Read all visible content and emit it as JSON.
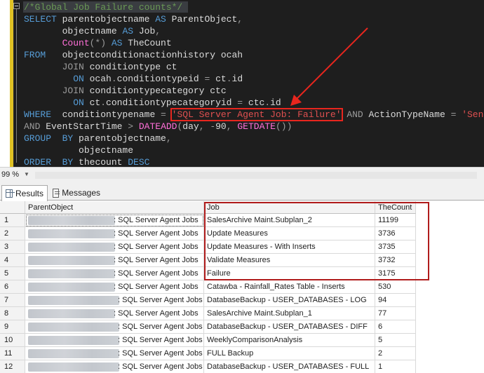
{
  "editor": {
    "lines": [
      [
        {
          "t": "/*Global Job Failure counts*/",
          "c": "cmt"
        }
      ],
      [
        {
          "t": "SELECT",
          "c": "kw"
        },
        {
          "t": " parentobjectname "
        },
        {
          "t": "AS",
          "c": "kw"
        },
        {
          "t": " ParentObject"
        },
        {
          "t": ",",
          "c": "gray"
        }
      ],
      [
        {
          "t": "       objectname "
        },
        {
          "t": "AS",
          "c": "kw"
        },
        {
          "t": " Job"
        },
        {
          "t": ",",
          "c": "gray"
        }
      ],
      [
        {
          "t": "       "
        },
        {
          "t": "Count",
          "c": "fn"
        },
        {
          "t": "(*)",
          "c": "gray"
        },
        {
          "t": " "
        },
        {
          "t": "AS",
          "c": "kw"
        },
        {
          "t": " TheCount"
        }
      ],
      [
        {
          "t": "FROM",
          "c": "kw"
        },
        {
          "t": "   objectconditionactionhistory ocah"
        }
      ],
      [
        {
          "t": "       "
        },
        {
          "t": "JOIN",
          "c": "gray"
        },
        {
          "t": " conditiontype ct"
        }
      ],
      [
        {
          "t": "         "
        },
        {
          "t": "ON",
          "c": "kw"
        },
        {
          "t": " ocah"
        },
        {
          "t": ".",
          "c": "gray"
        },
        {
          "t": "conditiontypeid "
        },
        {
          "t": "=",
          "c": "gray"
        },
        {
          "t": " ct"
        },
        {
          "t": ".",
          "c": "gray"
        },
        {
          "t": "id"
        }
      ],
      [
        {
          "t": "       "
        },
        {
          "t": "JOIN",
          "c": "gray"
        },
        {
          "t": " conditiontypecategory ctc"
        }
      ],
      [
        {
          "t": "         "
        },
        {
          "t": "ON",
          "c": "kw"
        },
        {
          "t": " ct"
        },
        {
          "t": ".",
          "c": "gray"
        },
        {
          "t": "conditiontypecategoryid "
        },
        {
          "t": "=",
          "c": "gray"
        },
        {
          "t": " ctc"
        },
        {
          "t": ".",
          "c": "gray"
        },
        {
          "t": "id"
        }
      ],
      [
        {
          "t": "WHERE",
          "c": "kw"
        },
        {
          "t": "  conditiontypename "
        },
        {
          "t": "=",
          "c": "gray"
        },
        {
          "t": " "
        },
        {
          "t": "'SQL Server Agent Job: Failure'",
          "c": "str",
          "hl": true
        },
        {
          "t": " "
        },
        {
          "t": "AND",
          "c": "gray"
        },
        {
          "t": " ActionTypeName "
        },
        {
          "t": "=",
          "c": "gray"
        },
        {
          "t": " "
        },
        {
          "t": "'Send Email'",
          "c": "str"
        }
      ],
      [
        {
          "t": "AND",
          "c": "gray"
        },
        {
          "t": " EventStartTime "
        },
        {
          "t": ">",
          "c": "gray"
        },
        {
          "t": " "
        },
        {
          "t": "DATEADD",
          "c": "fn"
        },
        {
          "t": "(",
          "c": "gray"
        },
        {
          "t": "day"
        },
        {
          "t": ",",
          "c": "gray"
        },
        {
          "t": " "
        },
        {
          "t": "-",
          "c": "gray"
        },
        {
          "t": "90"
        },
        {
          "t": ",",
          "c": "gray"
        },
        {
          "t": " "
        },
        {
          "t": "GETDATE",
          "c": "fn"
        },
        {
          "t": "())",
          "c": "gray"
        }
      ],
      [
        {
          "t": "GROUP",
          "c": "kw"
        },
        {
          "t": "  "
        },
        {
          "t": "BY",
          "c": "kw"
        },
        {
          "t": " parentobjectname"
        },
        {
          "t": ",",
          "c": "gray"
        }
      ],
      [
        {
          "t": "          objectname"
        }
      ],
      [
        {
          "t": "ORDER",
          "c": "kw"
        },
        {
          "t": "  "
        },
        {
          "t": "BY",
          "c": "kw"
        },
        {
          "t": " thecount "
        },
        {
          "t": "DESC",
          "c": "kw"
        }
      ]
    ]
  },
  "zoom": {
    "label": "99 %"
  },
  "tabs": {
    "results": "Results",
    "messages": "Messages"
  },
  "grid": {
    "columns": [
      "ParentObject",
      "Job",
      "TheCount"
    ],
    "rows": [
      {
        "n": "1",
        "parent_suffix": ": SQL Server Agent Jobs",
        "job": "SalesArchive Maint.Subplan_2",
        "count": "11199"
      },
      {
        "n": "2",
        "parent_suffix": ": SQL Server Agent Jobs",
        "job": "Update Measures",
        "count": "3736"
      },
      {
        "n": "3",
        "parent_suffix": ": SQL Server Agent Jobs",
        "job": "Update Measures - With Inserts",
        "count": "3735"
      },
      {
        "n": "4",
        "parent_suffix": ": SQL Server Agent Jobs",
        "job": "Validate Measures",
        "count": "3732"
      },
      {
        "n": "5",
        "parent_suffix": ": SQL Server Agent Jobs",
        "job": "Failure",
        "count": "3175"
      },
      {
        "n": "6",
        "parent_suffix": ": SQL Server Agent Jobs",
        "job": "Catawba - Rainfall_Rates Table - Inserts",
        "count": "530"
      },
      {
        "n": "7",
        "parent_suffix": ": SQL Server Agent Jobs",
        "job": "DatabaseBackup - USER_DATABASES - LOG",
        "count": "94"
      },
      {
        "n": "8",
        "parent_suffix": ": SQL Server Agent Jobs",
        "job": "SalesArchive Maint.Subplan_1",
        "count": "77"
      },
      {
        "n": "9",
        "parent_suffix": ": SQL Server Agent Jobs",
        "job": "DatabaseBackup - USER_DATABASES - DIFF",
        "count": "6"
      },
      {
        "n": "10",
        "parent_suffix": ": SQL Server Agent Jobs",
        "job": "WeeklyComparisonAnalysis",
        "count": "5"
      },
      {
        "n": "11",
        "parent_suffix": ": SQL Server Agent Jobs",
        "job": "FULL Backup",
        "count": "2"
      },
      {
        "n": "12",
        "parent_suffix": ": SQL Server Agent Jobs",
        "job": "DatabaseBackup - USER_DATABASES - FULL",
        "count": "1"
      }
    ]
  },
  "colors": {
    "annotation": "#e8261e",
    "highlight_box": "#b01c1c"
  },
  "icons": {
    "results_tab": "grid-icon",
    "messages_tab": "messages-icon"
  }
}
